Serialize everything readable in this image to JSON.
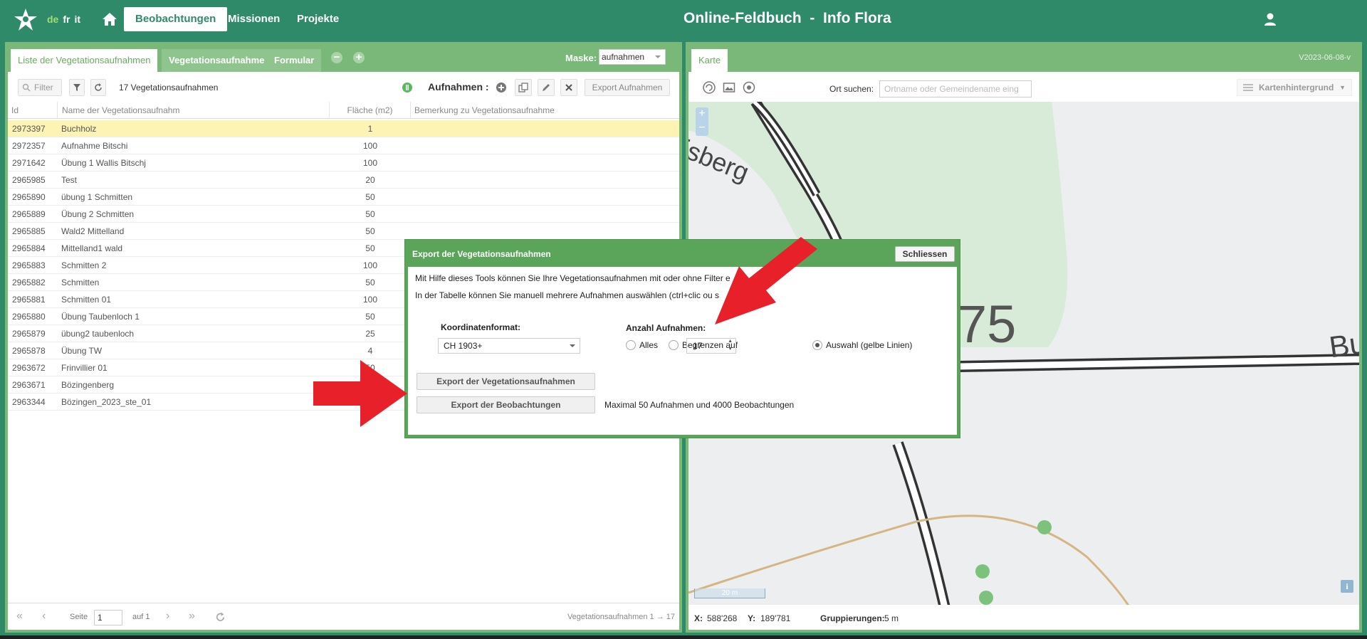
{
  "topbar": {
    "languages": [
      "de",
      "fr",
      "it"
    ],
    "nav": [
      "Beobachtungen",
      "Missionen",
      "Projekte"
    ],
    "title": "Online-Feldbuch  -  Info Flora"
  },
  "left": {
    "tabs": [
      "Liste der Vegetationsaufnahmen",
      "Vegetationsaufnahme",
      "Formular"
    ],
    "mask_label": "Maske:",
    "mask_value": "aufnahmen",
    "filter_placeholder": "Filter",
    "count_label": "17 Vegetationsaufnahmen",
    "aufnahmen_label": "Aufnahmen :",
    "export_label": "Export Aufnahmen",
    "columns": [
      "Id",
      "Name der Vegetationsaufnahm",
      "Fläche (m2)",
      "Bemerkung zu Vegetationsaufnahme"
    ],
    "rows": [
      {
        "id": "2973397",
        "name": "Buchholz",
        "area": "1",
        "note": ""
      },
      {
        "id": "2972357",
        "name": "Aufnahme Bitschi",
        "area": "100",
        "note": ""
      },
      {
        "id": "2971642",
        "name": "Übung 1 Wallis Bitschj",
        "area": "100",
        "note": ""
      },
      {
        "id": "2965985",
        "name": "Test",
        "area": "20",
        "note": ""
      },
      {
        "id": "2965890",
        "name": "übung 1 Schmitten",
        "area": "50",
        "note": ""
      },
      {
        "id": "2965889",
        "name": "Übung 2 Schmitten",
        "area": "50",
        "note": ""
      },
      {
        "id": "2965885",
        "name": "Wald2 Mittelland",
        "area": "50",
        "note": ""
      },
      {
        "id": "2965884",
        "name": "Mittelland1 wald",
        "area": "50",
        "note": ""
      },
      {
        "id": "2965883",
        "name": "Schmitten 2",
        "area": "100",
        "note": ""
      },
      {
        "id": "2965882",
        "name": "Schmitten",
        "area": "50",
        "note": ""
      },
      {
        "id": "2965881",
        "name": "Schmitten 01",
        "area": "100",
        "note": ""
      },
      {
        "id": "2965880",
        "name": "Übung Taubenloch 1",
        "area": "50",
        "note": ""
      },
      {
        "id": "2965879",
        "name": "übung2 taubenloch",
        "area": "25",
        "note": ""
      },
      {
        "id": "2965878",
        "name": "Übung TW",
        "area": "4",
        "note": ""
      },
      {
        "id": "2963672",
        "name": "Frinvillier 01",
        "area": "50",
        "note": ""
      },
      {
        "id": "2963671",
        "name": "Bözingenberg",
        "area": "",
        "note": ""
      },
      {
        "id": "2963344",
        "name": "Bözingen_2023_ste_01",
        "area": "",
        "note": ""
      }
    ],
    "pager": {
      "page_label": "Seite",
      "page_value": "1",
      "of_label": "auf 1",
      "summary": "Vegetationsaufnahmen 1 → 17"
    }
  },
  "right": {
    "tab": "Karte",
    "version": "V2023-06-08-v",
    "ort_label": "Ort suchen:",
    "ort_placeholder": "Ortname oder Gemeindename eing",
    "background_label": "Kartenhintergrund",
    "map_labels": [
      "isberg",
      "75",
      "Bu"
    ],
    "scale": "20 m",
    "footer": {
      "x_label": "X:",
      "x_value": "588'268",
      "y_label": "Y:",
      "y_value": "189'781",
      "group_label": "Gruppierungen:",
      "group_value": "5 m"
    }
  },
  "dialog": {
    "title": "Export der Vegetationsaufnahmen",
    "close": "Schliessen",
    "line1": "Mit Hilfe dieses Tools können Sie Ihre Vegetationsaufnahmen mit oder ohne Filter e",
    "line2": "In der Tabelle können Sie manuell mehrere Aufnahmen auswählen (ctrl+clic ou s",
    "coord_label": "Koordinatenformat:",
    "coord_value": "CH 1903+",
    "count_label": "Anzahl Aufnahmen:",
    "opt_all": "Alles",
    "opt_limit": "Begrenzen auf",
    "limit_value": "17",
    "opt_selection": "Auswahl (gelbe Linien)",
    "btn_export_veg": "Export der Vegetationsaufnahmen",
    "btn_export_obs": "Export der Beobachtungen",
    "max_note": "Maximal 50 Aufnahmen und 4000 Beobachtungen"
  },
  "colors": {
    "brand": "#2f8a6a",
    "panel": "#7ab87a",
    "dialog": "#5aa55a",
    "selected_row": "#fdf3b5",
    "arrow": "#e8202a"
  }
}
